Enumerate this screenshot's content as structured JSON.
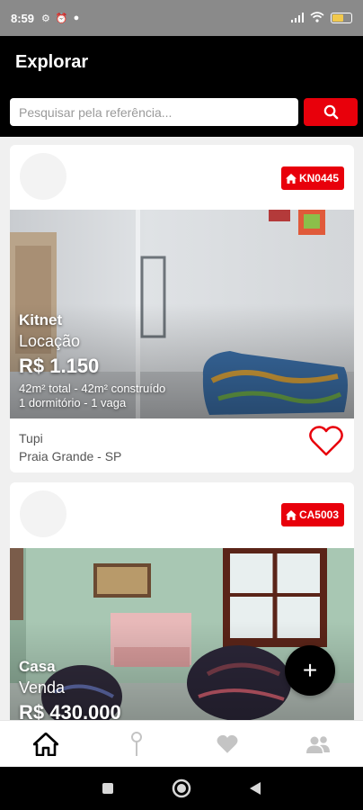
{
  "status_bar": {
    "time": "8:59",
    "battery": "55"
  },
  "header": {
    "title": "Explorar"
  },
  "search": {
    "placeholder": "Pesquisar pela referência..."
  },
  "listings": [
    {
      "ref": "KN0445",
      "type": "Kitnet",
      "deal": "Locação",
      "price": "R$ 1.150",
      "area": "42m² total - 42m² construído",
      "rooms": "1 dormitório - 1 vaga",
      "neighborhood": "Tupi",
      "city": "Praia Grande - SP"
    },
    {
      "ref": "CA5003",
      "type": "Casa",
      "deal": "Venda",
      "price": "R$ 430.000"
    }
  ],
  "fab": {
    "label": "+"
  },
  "bottom_nav": [
    "home-icon",
    "location-pin-icon",
    "favorites-heart-icon",
    "users-icon"
  ],
  "colors": {
    "accent": "#e8000b",
    "header": "#000000",
    "background": "#f0f0f0"
  }
}
